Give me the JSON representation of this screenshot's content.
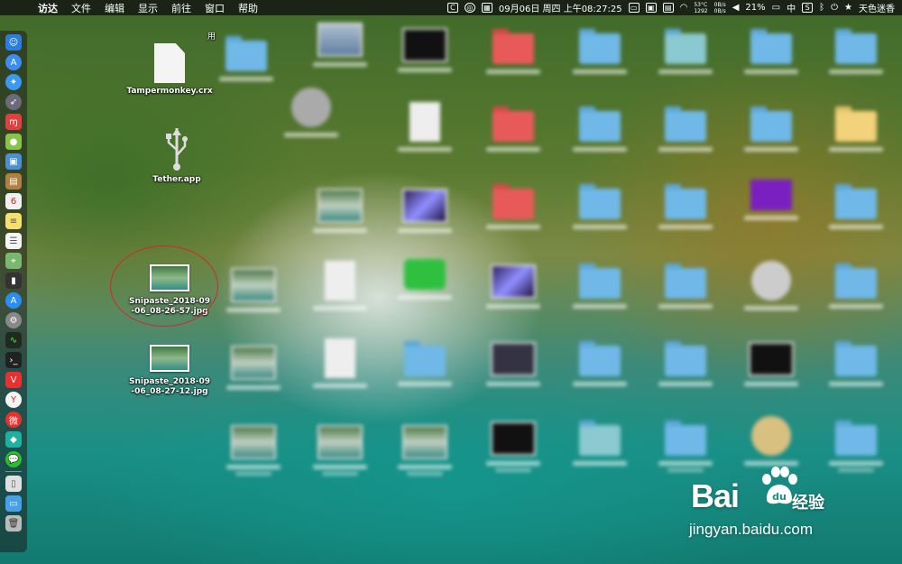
{
  "menubar": {
    "app_name": "访达",
    "menus": [
      "文件",
      "编辑",
      "显示",
      "前往",
      "窗口",
      "帮助"
    ],
    "status": {
      "c_badge": "C",
      "date_time": "09月06日 周四 上午08:27:25",
      "temp": "53°C",
      "fan": "1292",
      "net_up": "0B/s",
      "net_down": "0B/s",
      "battery": "21%",
      "input_method": "中",
      "s_badge": "S",
      "user": "天色迷香"
    }
  },
  "desktop": {
    "icons": [
      {
        "label": "Tampermonkey.crx",
        "extra": "用"
      },
      {
        "label": "Tether.app"
      },
      {
        "label": "Snipaste_2018-09\n-06_08-26-57.jpg"
      },
      {
        "label": "Snipaste_2018-09\n-06_08-27-12.jpg"
      }
    ]
  },
  "watermark": {
    "brand": "Bai",
    "brand_suffix": "经验",
    "url": "jingyan.baidu.com"
  },
  "colors": {
    "menubar_bg": "#1a1a1a",
    "folder_blue": "#6fb8e8",
    "folder_red": "#e85a5a",
    "highlight": "#d02a2a"
  }
}
